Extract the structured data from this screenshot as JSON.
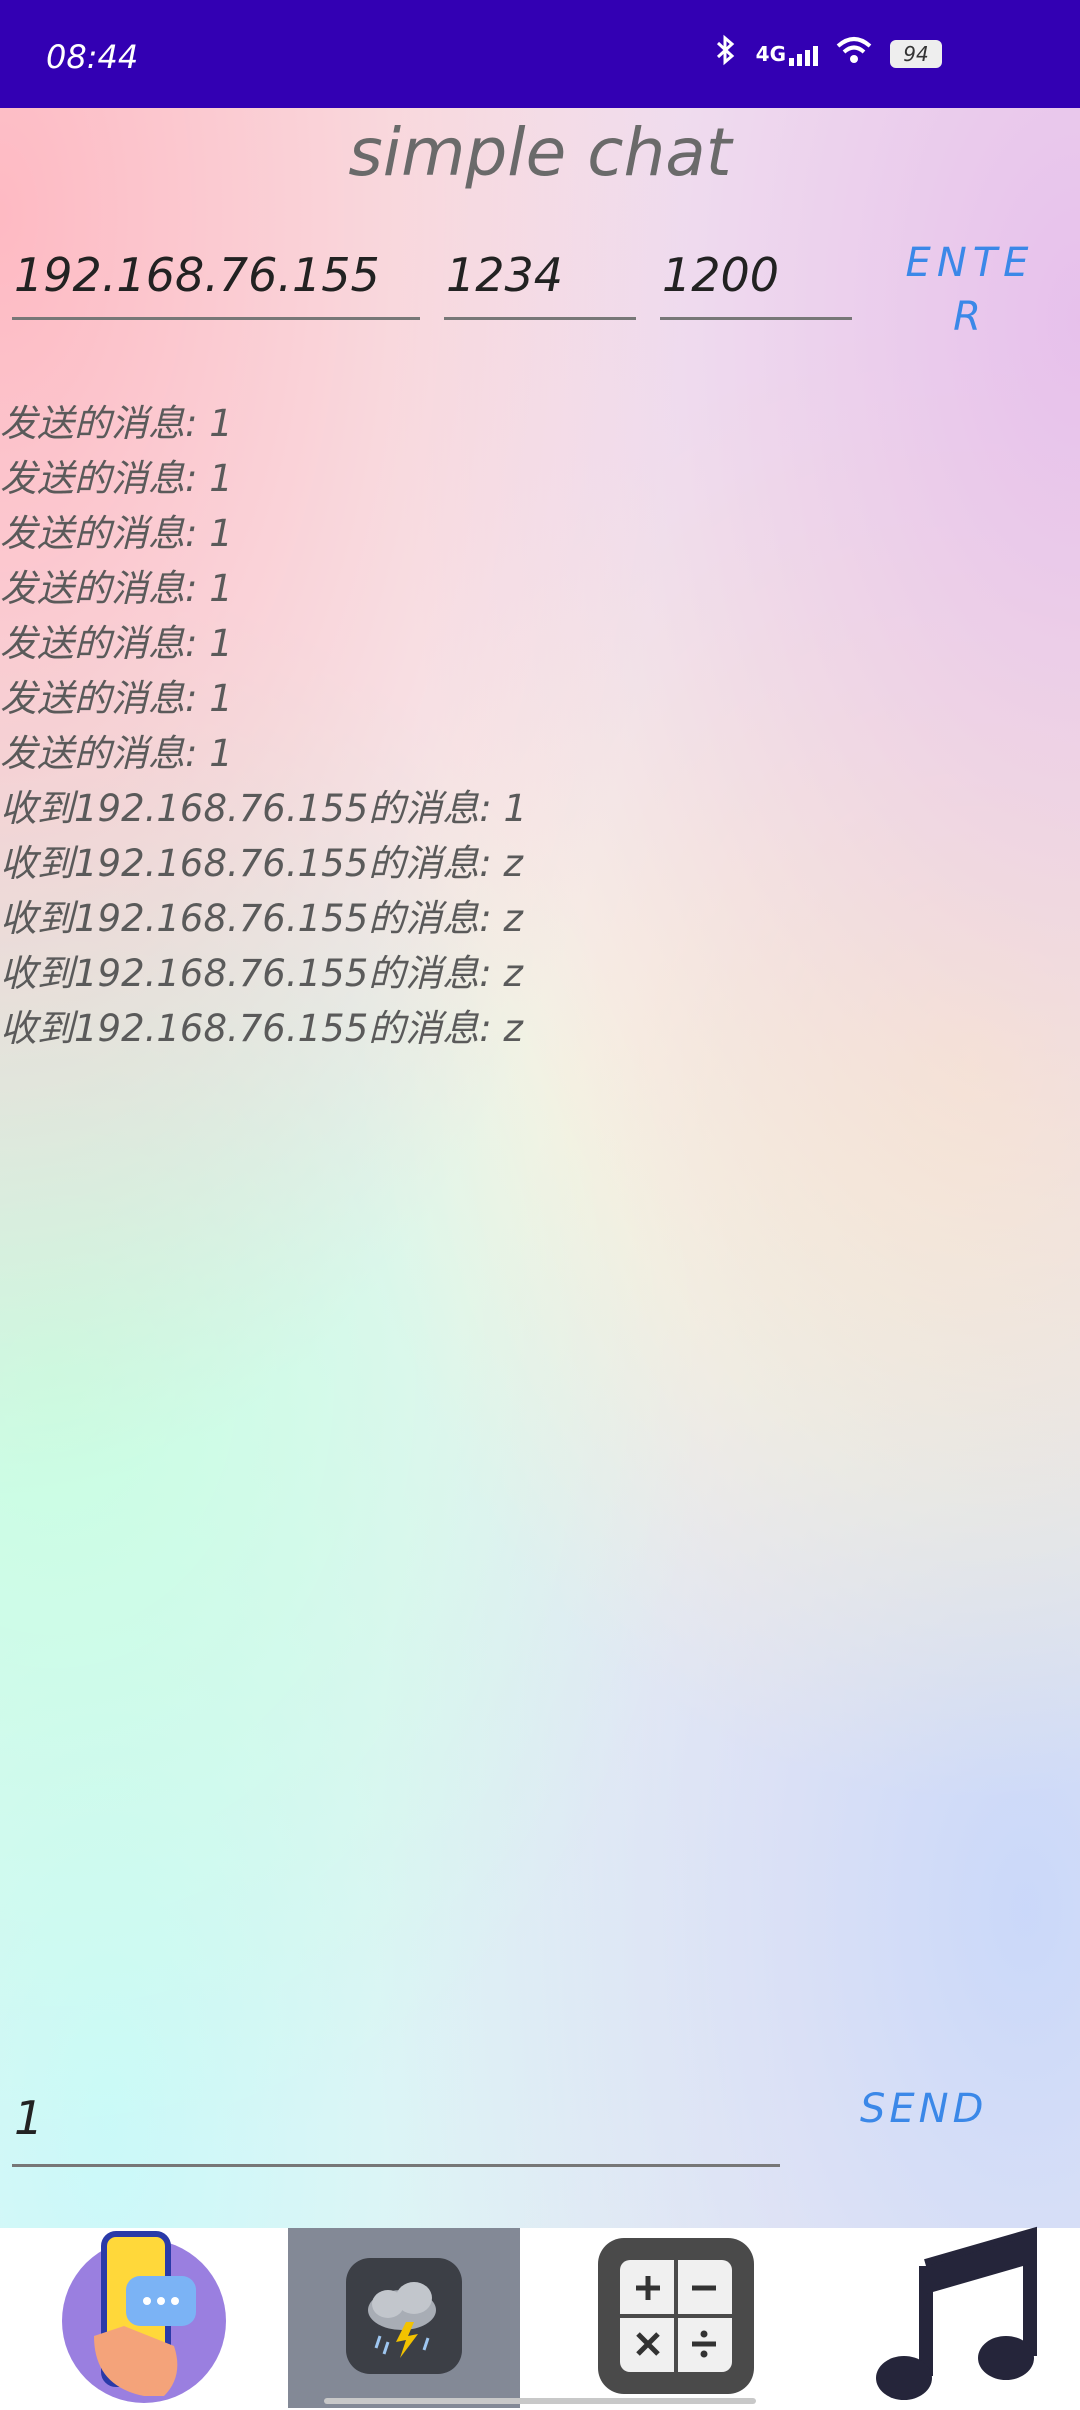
{
  "status_bar": {
    "time": "08:44",
    "network": "4G",
    "battery": "94"
  },
  "app": {
    "title": "simple chat",
    "ip_value": "192.168.76.155",
    "port_value": "1234",
    "size_value": "1200",
    "enter_label": "ENTER",
    "messages": [
      "发送的消息: 1",
      "发送的消息: 1",
      "发送的消息: 1",
      "发送的消息: 1",
      "发送的消息: 1",
      "发送的消息: 1",
      "发送的消息: 1",
      "收到192.168.76.155的消息: 1",
      "收到192.168.76.155的消息: z",
      "收到192.168.76.155的消息: z",
      "收到192.168.76.155的消息: z",
      "收到192.168.76.155的消息: z"
    ],
    "message_input_value": "1",
    "send_label": "SEND"
  },
  "bottom_nav": {
    "items": [
      "chat-app-icon",
      "weather-app-icon",
      "calculator-app-icon",
      "music-app-icon"
    ]
  },
  "colors": {
    "status_bar": "#3300b3",
    "accent": "#3b88e8",
    "selected_nav": "#838996"
  }
}
